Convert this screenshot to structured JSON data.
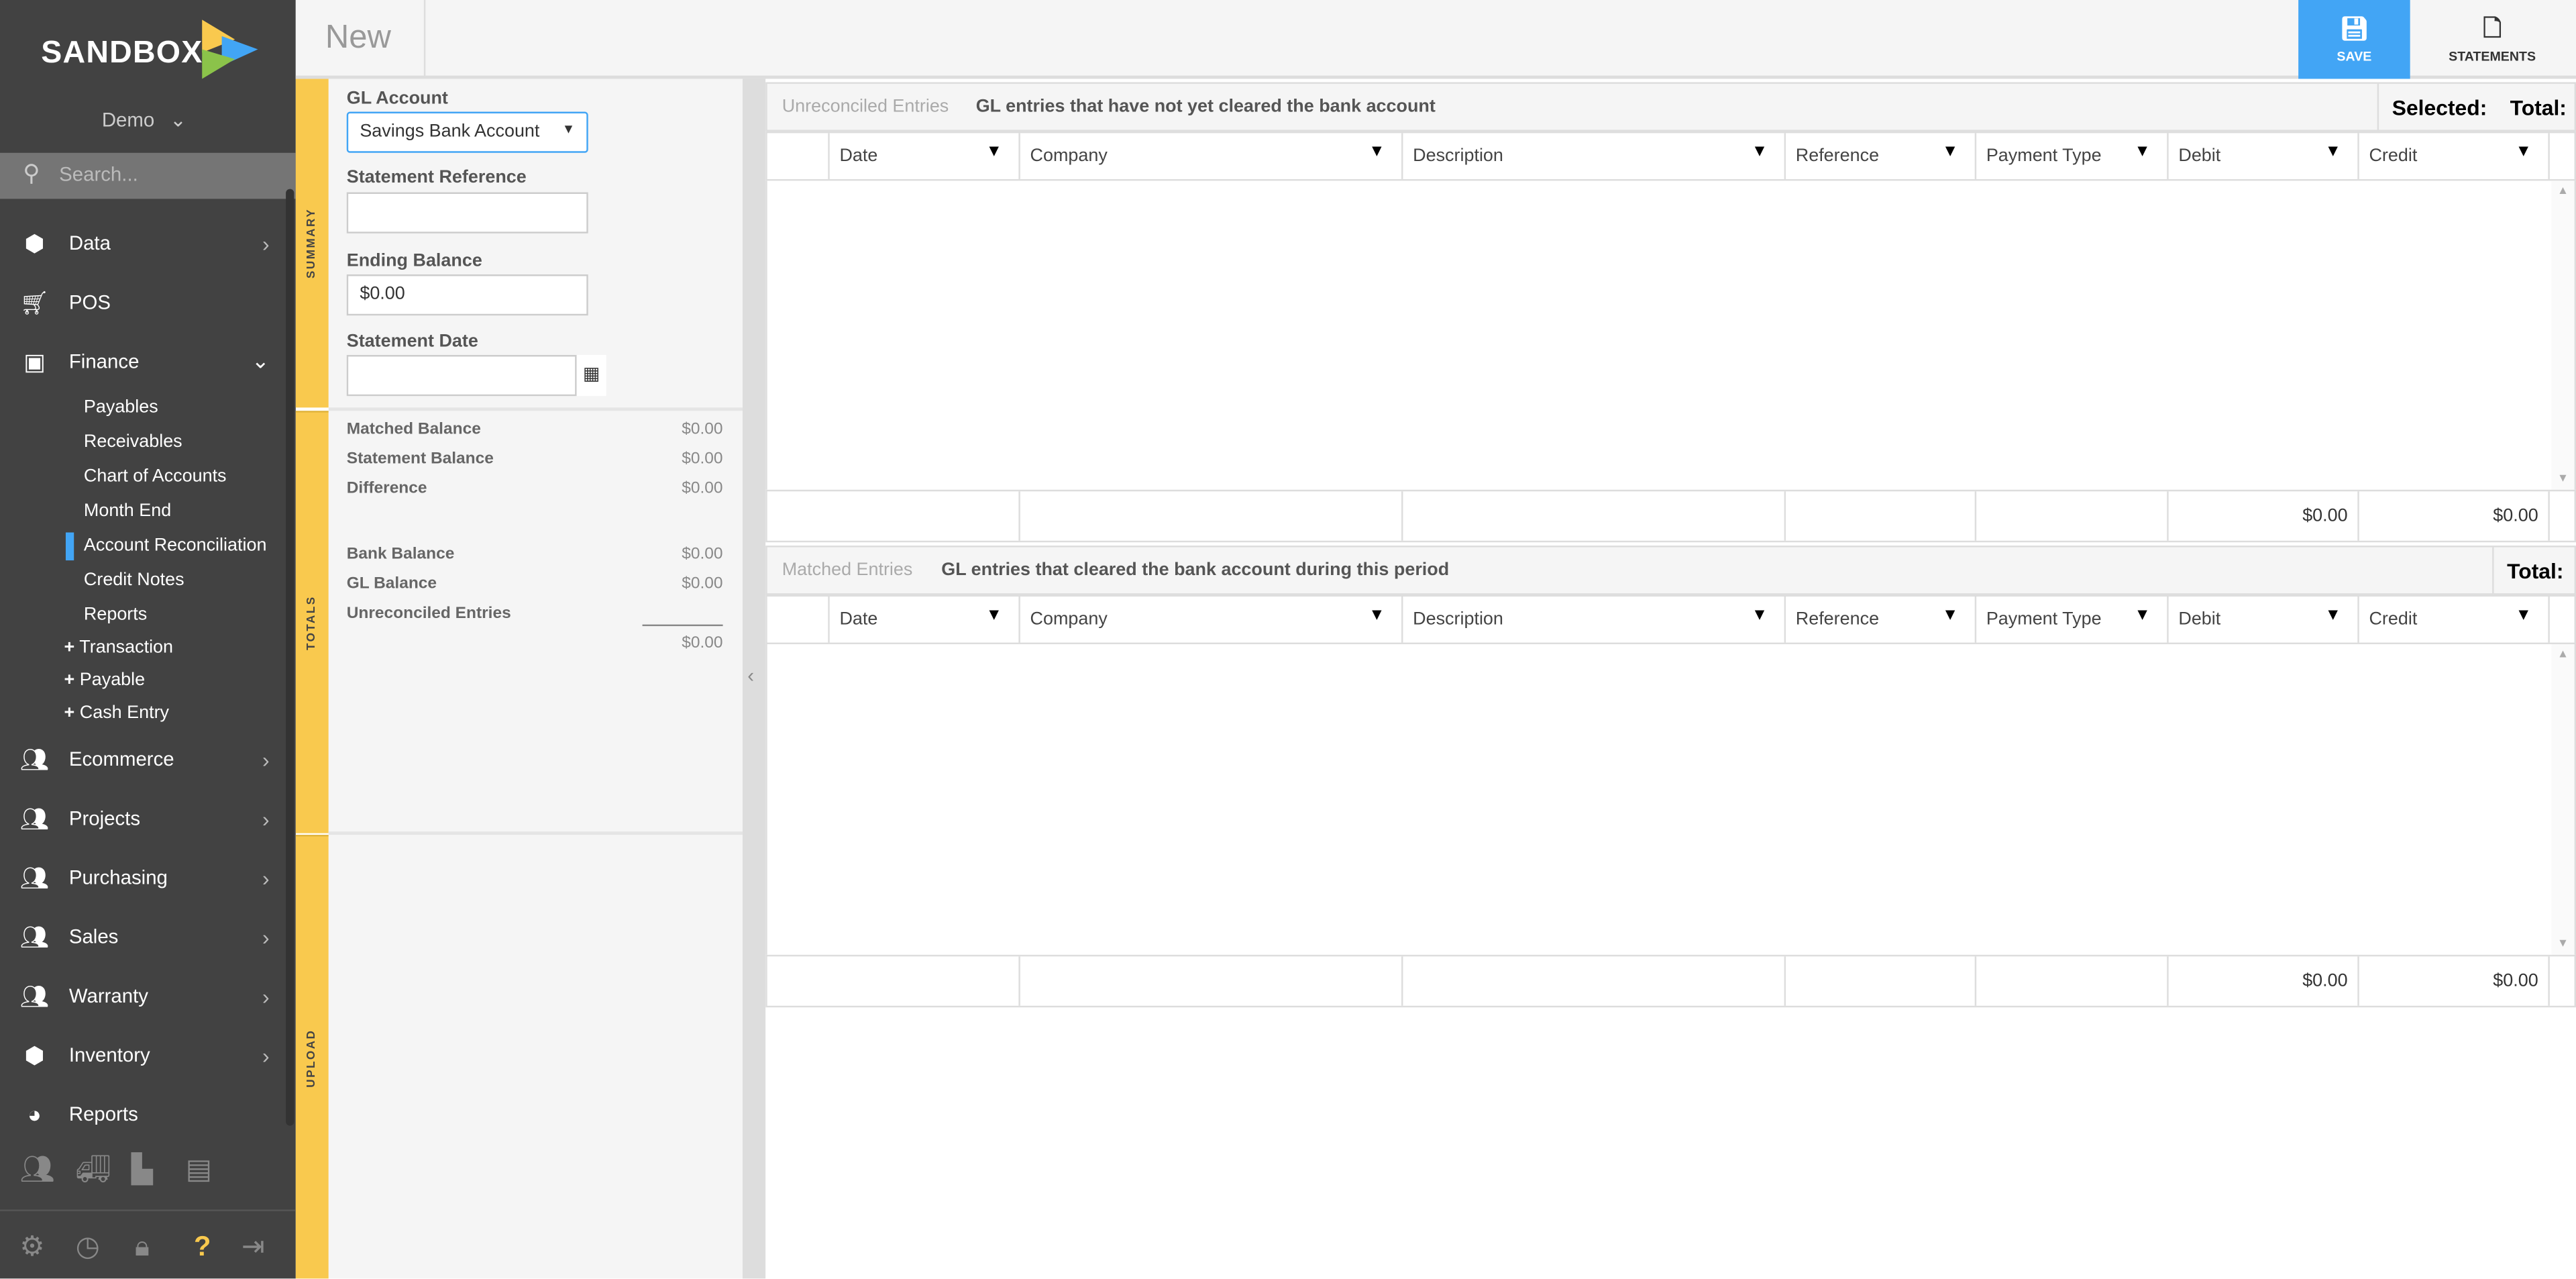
{
  "brand": {
    "name": "SANDBOX",
    "accent": "#42a5f5",
    "yellow": "#f9c94e"
  },
  "sidebar": {
    "tenant": "Demo",
    "search_placeholder": "Search...",
    "items": [
      {
        "label": "Data",
        "icon": "cube-icon"
      },
      {
        "label": "POS",
        "icon": "cart-icon"
      },
      {
        "label": "Finance",
        "icon": "money-icon"
      },
      {
        "label": "Ecommerce",
        "icon": "users-icon"
      },
      {
        "label": "Projects",
        "icon": "users-icon"
      },
      {
        "label": "Purchasing",
        "icon": "users-icon"
      },
      {
        "label": "Sales",
        "icon": "users-icon"
      },
      {
        "label": "Warranty",
        "icon": "users-icon"
      },
      {
        "label": "Inventory",
        "icon": "cubes-icon"
      },
      {
        "label": "Reports",
        "icon": "pie-chart-icon"
      }
    ],
    "finance_sub": [
      "Payables",
      "Receivables",
      "Chart of Accounts",
      "Month End",
      "Account Reconciliation",
      "Credit Notes",
      "Reports"
    ],
    "finance_add": [
      "Transaction",
      "Payable",
      "Cash Entry"
    ]
  },
  "header": {
    "title": "New",
    "save_label": "SAVE",
    "statements_label": "STATEMENTS"
  },
  "tabs": {
    "summary": "SUMMARY",
    "totals": "TOTALS",
    "upload": "UPLOAD"
  },
  "form": {
    "gl_account_label": "GL Account",
    "gl_account_value": "Savings Bank Account",
    "statement_reference_label": "Statement Reference",
    "statement_reference_value": "",
    "ending_balance_label": "Ending Balance",
    "ending_balance_value": "$0.00",
    "statement_date_label": "Statement Date",
    "statement_date_value": ""
  },
  "totals": {
    "matched_balance": {
      "label": "Matched Balance",
      "value": "$0.00"
    },
    "statement_balance": {
      "label": "Statement Balance",
      "value": "$0.00"
    },
    "difference": {
      "label": "Difference",
      "value": "$0.00"
    },
    "bank_balance": {
      "label": "Bank Balance",
      "value": "$0.00"
    },
    "gl_balance": {
      "label": "GL Balance",
      "value": "$0.00"
    },
    "unreconciled_entries": {
      "label": "Unreconciled Entries",
      "value": "$0.00"
    }
  },
  "columns": [
    "Date",
    "Company",
    "Description",
    "Reference",
    "Payment Type",
    "Debit",
    "Credit"
  ],
  "unreconciled": {
    "title": "Unreconciled Entries",
    "subtitle": "GL entries that have not yet cleared the bank account",
    "selected_label": "Selected:",
    "total_label": "Total:",
    "debit_total": "$0.00",
    "credit_total": "$0.00"
  },
  "matched": {
    "title": "Matched Entries",
    "subtitle": "GL entries that cleared the bank account during this period",
    "total_label": "Total:",
    "debit_total": "$0.00",
    "credit_total": "$0.00"
  }
}
